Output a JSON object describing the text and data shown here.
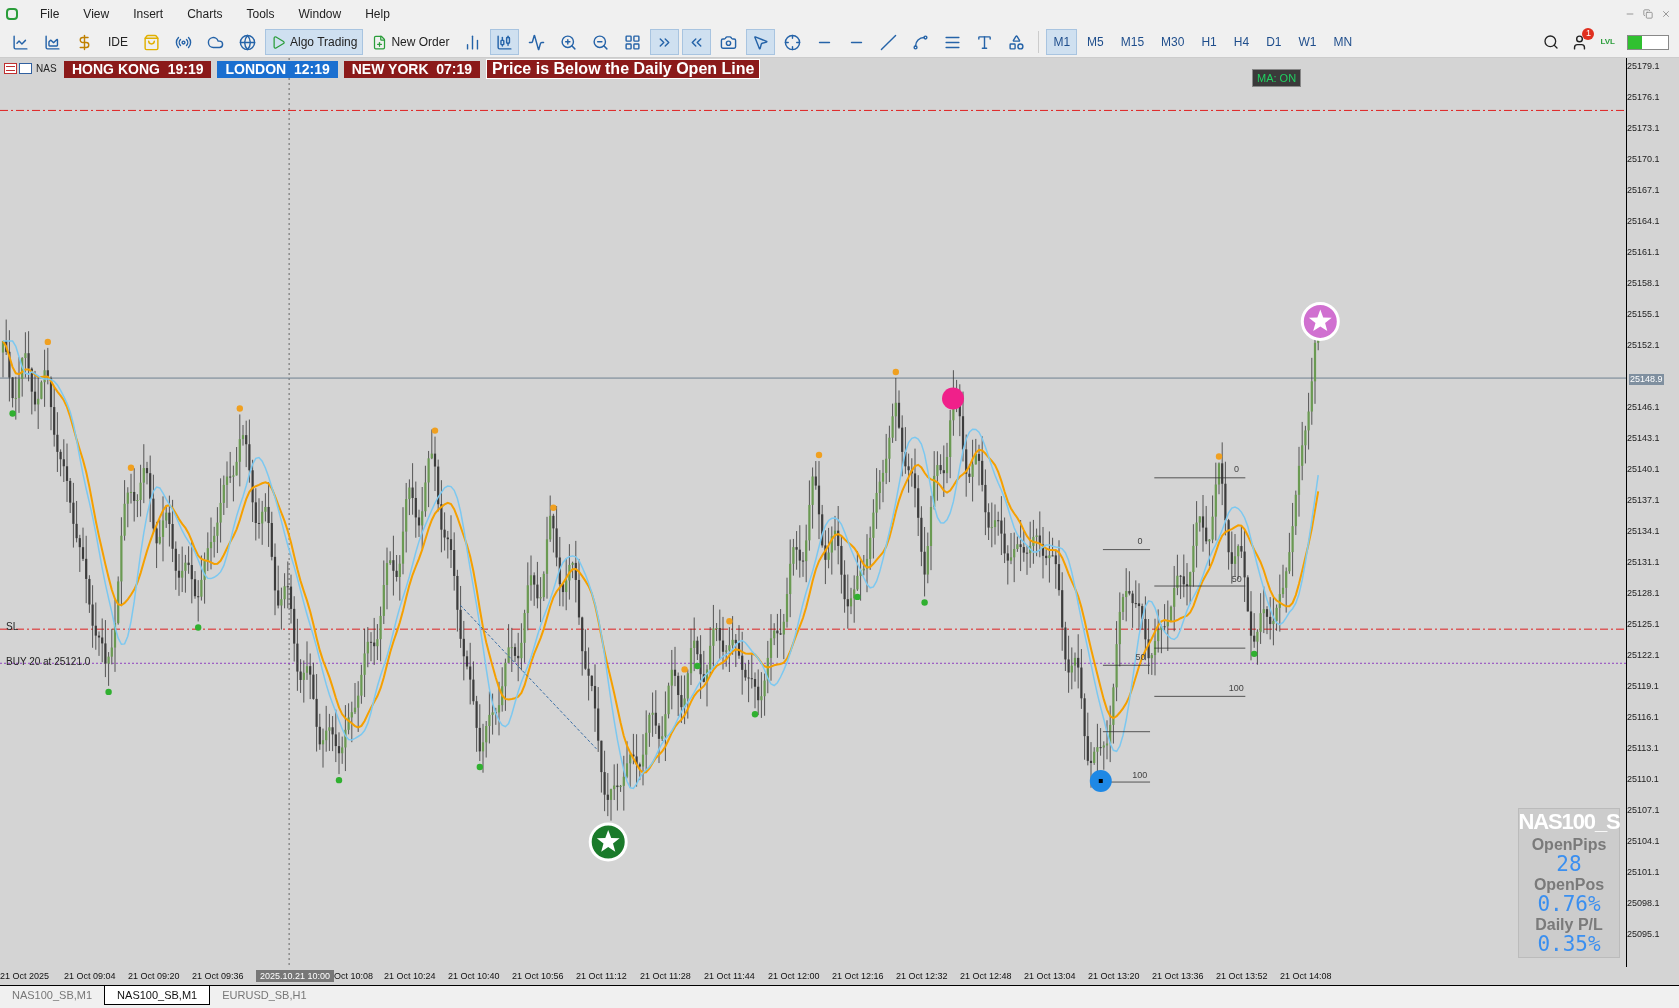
{
  "menu": [
    "File",
    "View",
    "Insert",
    "Charts",
    "Tools",
    "Window",
    "Help"
  ],
  "toolbar": {
    "tools": [
      {
        "kind": "line-chart",
        "pressed": false
      },
      {
        "kind": "chart-window",
        "pressed": false
      },
      {
        "kind": "dollar",
        "pressed": false
      },
      {
        "kind": "ide",
        "label": "IDE",
        "pressed": false
      },
      {
        "kind": "bag",
        "pressed": false
      },
      {
        "kind": "signal",
        "pressed": false
      },
      {
        "kind": "cloud",
        "pressed": false
      },
      {
        "kind": "globe-plus",
        "pressed": false
      },
      {
        "kind": "algo",
        "label": "Algo Trading",
        "pressed": true
      },
      {
        "kind": "new-order",
        "label": "New Order",
        "pressed": false
      },
      {
        "kind": "bars",
        "pressed": false
      },
      {
        "kind": "candles",
        "pressed": true
      },
      {
        "kind": "line",
        "pressed": false
      },
      {
        "kind": "zoom-in",
        "pressed": false
      },
      {
        "kind": "zoom-out",
        "pressed": false
      },
      {
        "kind": "grid",
        "pressed": false
      },
      {
        "kind": "autoscroll",
        "pressed": true
      },
      {
        "kind": "shift",
        "pressed": true
      },
      {
        "kind": "camera",
        "pressed": false
      },
      {
        "kind": "cursor",
        "pressed": true
      },
      {
        "kind": "crosshair",
        "pressed": false
      },
      {
        "kind": "vline",
        "pressed": false
      },
      {
        "kind": "hline",
        "pressed": false
      },
      {
        "kind": "trendline",
        "pressed": false
      },
      {
        "kind": "channel",
        "pressed": false
      },
      {
        "kind": "fibo",
        "pressed": false
      },
      {
        "kind": "text",
        "pressed": false
      },
      {
        "kind": "shapes",
        "pressed": false
      }
    ],
    "timeframes": [
      {
        "label": "M1",
        "selected": true
      },
      {
        "label": "M5",
        "selected": false
      },
      {
        "label": "M15",
        "selected": false
      },
      {
        "label": "M30",
        "selected": false
      },
      {
        "label": "H1",
        "selected": false
      },
      {
        "label": "H4",
        "selected": false
      },
      {
        "label": "D1",
        "selected": false
      },
      {
        "label": "W1",
        "selected": false
      },
      {
        "label": "MN",
        "selected": false
      }
    ],
    "notifications": "1",
    "lvl": "LVL"
  },
  "chart": {
    "symbol": "NAS",
    "sessions": [
      {
        "name": "HONG KONG",
        "time": "19:19",
        "color": "#8b1a1a"
      },
      {
        "name": "LONDON",
        "time": "12:19",
        "color": "#1a6fd0"
      },
      {
        "name": "NEW YORK",
        "time": "07:19",
        "color": "#8b1a1a"
      }
    ],
    "alert": "Price is Below the Daily Open Line",
    "ma_badge": "MA: ON",
    "sl_label": "SL",
    "buy_label": "BUY 20 at 25121.0",
    "fib_labels": [
      "0",
      "0",
      "50",
      "50",
      "100",
      "100"
    ],
    "price_ticks": [
      "25179.1",
      "25176.1",
      "25173.1",
      "25170.1",
      "25167.1",
      "25164.1",
      "25161.1",
      "25158.1",
      "25155.1",
      "25152.1",
      "25146.1",
      "25143.1",
      "25140.1",
      "25137.1",
      "25134.1",
      "25131.1",
      "25128.1",
      "25125.1",
      "25122.1",
      "25119.1",
      "25116.1",
      "25113.1",
      "25110.1",
      "25107.1",
      "25104.1",
      "25101.1",
      "25098.1",
      "25095.1"
    ],
    "current_price": "25148.9",
    "time_ticks": [
      {
        "label": "21 Oct 2025",
        "selected": false
      },
      {
        "label": "21 Oct 09:04",
        "selected": false
      },
      {
        "label": "21 Oct 09:20",
        "selected": false
      },
      {
        "label": "21 Oct 09:36",
        "selected": false
      },
      {
        "label": "2025.10.21 10:00",
        "selected": true
      },
      {
        "label": "Oct 10:08",
        "selected": false
      },
      {
        "label": "21 Oct 10:24",
        "selected": false
      },
      {
        "label": "21 Oct 10:40",
        "selected": false
      },
      {
        "label": "21 Oct 10:56",
        "selected": false
      },
      {
        "label": "21 Oct 11:12",
        "selected": false
      },
      {
        "label": "21 Oct 11:28",
        "selected": false
      },
      {
        "label": "21 Oct 11:44",
        "selected": false
      },
      {
        "label": "21 Oct 12:00",
        "selected": false
      },
      {
        "label": "21 Oct 12:16",
        "selected": false
      },
      {
        "label": "21 Oct 12:32",
        "selected": false
      },
      {
        "label": "21 Oct 12:48",
        "selected": false
      },
      {
        "label": "21 Oct 13:04",
        "selected": false
      },
      {
        "label": "21 Oct 13:20",
        "selected": false
      },
      {
        "label": "21 Oct 13:36",
        "selected": false
      },
      {
        "label": "21 Oct 13:52",
        "selected": false
      },
      {
        "label": "21 Oct 14:08",
        "selected": false
      }
    ],
    "panel": {
      "symbol": "NAS100_S",
      "metrics": [
        {
          "label": "OpenPips",
          "value": "28"
        },
        {
          "label": "OpenPos",
          "value": "0.76%"
        },
        {
          "label": "Daily P/L",
          "value": "0.35%"
        }
      ]
    }
  },
  "tabs": [
    {
      "label": "NAS100_SB,M1",
      "selected": false
    },
    {
      "label": "NAS100_SB,M1",
      "selected": true
    },
    {
      "label": "EURUSD_SB,H1",
      "selected": false
    }
  ]
}
